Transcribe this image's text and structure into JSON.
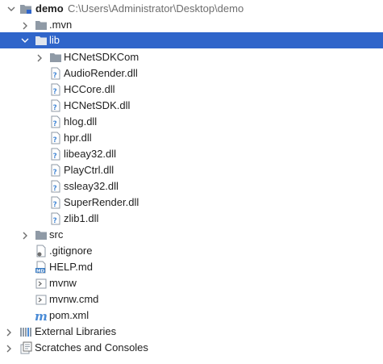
{
  "project": {
    "name": "demo",
    "path": "C:\\Users\\Administrator\\Desktop\\demo"
  },
  "items": {
    "mvn": ".mvn",
    "lib": "lib",
    "hcnetsdkcom": "HCNetSDKCom",
    "dlls": [
      "AudioRender.dll",
      "HCCore.dll",
      "HCNetSDK.dll",
      "hlog.dll",
      "hpr.dll",
      "libeay32.dll",
      "PlayCtrl.dll",
      "ssleay32.dll",
      "SuperRender.dll",
      "zlib1.dll"
    ],
    "src": "src",
    "gitignore": ".gitignore",
    "help": "HELP.md",
    "mvnw": "mvnw",
    "mvnw_cmd": "mvnw.cmd",
    "pom": "pom.xml",
    "external_libraries": "External Libraries",
    "scratches": "Scratches and Consoles"
  },
  "icons": {
    "folder": "folder-icon",
    "module": "module-folder-icon",
    "unknown_file": "unknown-file-icon",
    "gitignore": "gitignore-file-icon",
    "markdown": "markdown-file-icon",
    "shell": "shell-script-icon",
    "maven": "maven-pom-icon",
    "libraries": "external-libraries-icon",
    "scratches": "scratches-icon"
  },
  "colors": {
    "selection": "#2f65ca",
    "folder": "#8f9aa6",
    "path_text": "#6e6e6e"
  }
}
